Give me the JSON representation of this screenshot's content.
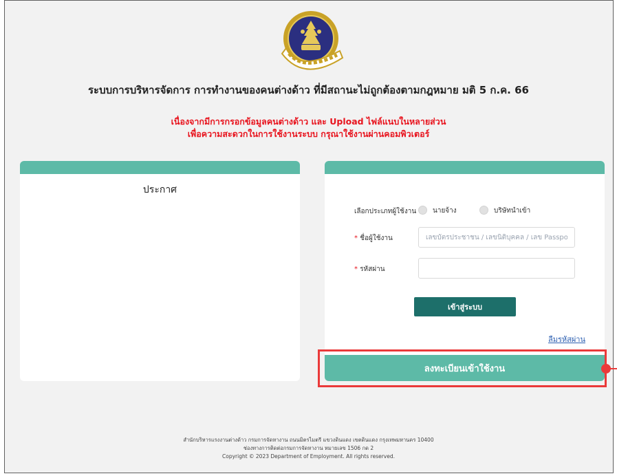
{
  "logo": {
    "text": "กรมการจัดหางาน",
    "icon": "department-seal-icon"
  },
  "header": {
    "system_title": "ระบบการบริหารจัดการ การทำงานของคนต่างด้าว ที่มีสถานะไม่ถูกต้องตามกฎหมาย มติ 5 ก.ค. 66",
    "notice_line1": "เนื่องจากมีการกรอกข้อมูลคนต่างด้าว และ Upload ไฟล์แนบในหลายส่วน",
    "notice_line2": "เพื่อความสะดวกในการใช้งานระบบ กรุณาใช้งานผ่านคอมพิวเตอร์"
  },
  "announcement": {
    "title": "ประกาศ"
  },
  "login": {
    "user_type_label": "เลือกประเภทผู้ใช้งาน",
    "user_types": [
      "นายจ้าง",
      "บริษัทนำเข้า"
    ],
    "required_mark": "*",
    "username_label": "ชื่อผู้ใช้งาน",
    "username_placeholder": "เลขบัตรประชาชน / เลขนิติบุคคล / เลข Passport",
    "password_label": "รหัสผ่าน",
    "login_button": "เข้าสู่ระบบ",
    "forgot_password": "ลืมรหัสผ่าน",
    "register_button": "ลงทะเบียนเข้าใช้งาน"
  },
  "footer": {
    "line1": "สำนักบริหารแรงงานต่างด้าว กรมการจัดหางาน ถนนมิตรไมตรี แขวงดินแดง เขตดินแดง กรุงเทพมหานคร 10400",
    "line2": "ช่องทางการติดต่อกรมการจัดหางาน หมายเลข 1506 กด 2",
    "line3": "Copyright © 2023 Department of Employment. All rights reserved."
  },
  "colors": {
    "accent": "#5dbaa7",
    "login_button": "#1d6f6a",
    "notice_text": "#e8141e",
    "highlight": "#ea3a3a"
  }
}
